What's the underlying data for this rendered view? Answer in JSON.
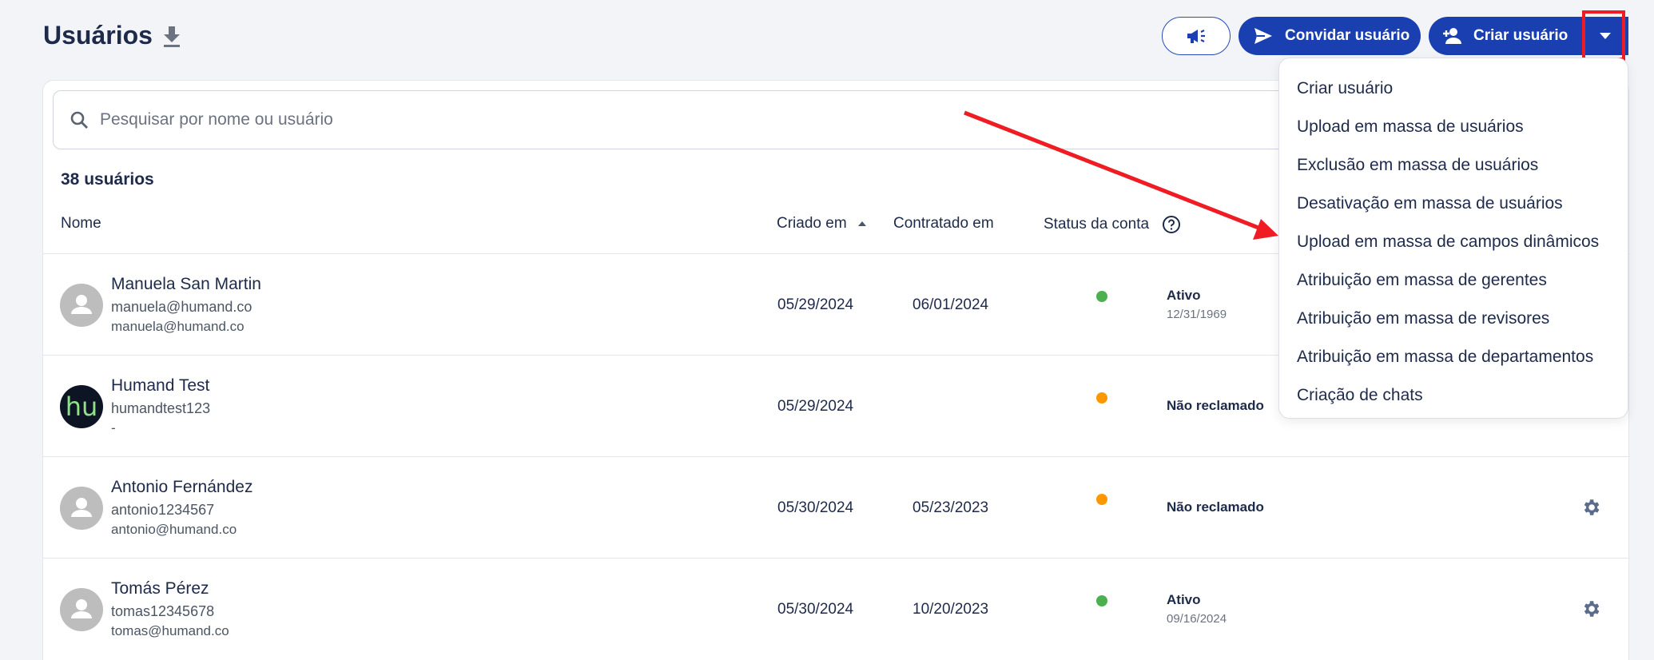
{
  "header": {
    "title": "Usuários",
    "invite_label": "Convidar usuário",
    "create_label": "Criar usuário"
  },
  "search": {
    "placeholder": "Pesquisar por nome ou usuário"
  },
  "table": {
    "count": "38 usuários",
    "columns": {
      "nome": "Nome",
      "criado": "Criado em",
      "contratado": "Contratado em",
      "status": "Status da conta"
    },
    "rows": [
      {
        "name": "Manuela San Martin",
        "username": "manuela@humand.co",
        "email": "manuela@humand.co",
        "created": "05/29/2024",
        "hired": "06/01/2024",
        "status": "Ativo",
        "status_date": "12/31/1969",
        "status_color": "#4caf50",
        "avatar": ""
      },
      {
        "name": "Humand Test",
        "username": "humandtest123",
        "email": "-",
        "created": "05/29/2024",
        "hired": "",
        "status": "Não reclamado",
        "status_date": "",
        "status_color": "#ff9800",
        "avatar": "hu"
      },
      {
        "name": "Antonio Fernández",
        "username": "antonio1234567",
        "email": "antonio@humand.co",
        "created": "05/30/2024",
        "hired": "05/23/2023",
        "status": "Não reclamado",
        "status_date": "",
        "status_color": "#ff9800",
        "avatar": ""
      },
      {
        "name": "Tomás Pérez",
        "username": "tomas12345678",
        "email": "tomas@humand.co",
        "created": "05/30/2024",
        "hired": "10/20/2023",
        "status": "Ativo",
        "status_date": "09/16/2024",
        "status_color": "#4caf50",
        "avatar": ""
      }
    ]
  },
  "dropdown": {
    "items": [
      "Criar usuário",
      "Upload em massa de usuários",
      "Exclusão em massa de usuários",
      "Desativação em massa de usuários",
      "Upload em massa de campos dinâmicos",
      "Atribuição em massa de gerentes",
      "Atribuição em massa de revisores",
      "Atribuição em massa de departamentos",
      "Criação de chats"
    ]
  },
  "colors": {
    "primary": "#1a3fb0",
    "highlight": "#ef1c24",
    "active": "#4caf50",
    "unclaimed": "#ff9800"
  }
}
